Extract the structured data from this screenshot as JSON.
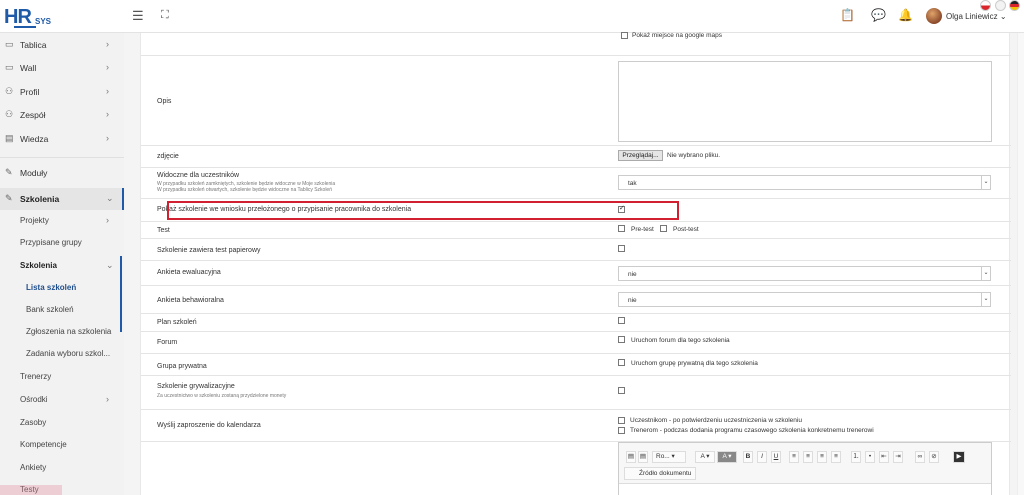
{
  "header": {
    "logo_main": "HR",
    "logo_sub": "SYS",
    "user_name": "Olga Liniewicz",
    "user_chevron": "⌄",
    "icons": [
      "menu-icon",
      "fullscreen-icon",
      "clipboard-icon",
      "chat-icon",
      "bell-icon"
    ]
  },
  "sidebar": {
    "items": [
      {
        "label": "Tablica",
        "icon": "dashboard-icon"
      },
      {
        "label": "Wall",
        "icon": "wall-icon"
      },
      {
        "label": "Profil",
        "icon": "user-icon"
      },
      {
        "label": "Zespół",
        "icon": "team-icon"
      },
      {
        "label": "Wiedza",
        "icon": "book-icon"
      },
      {
        "label": "Moduły",
        "icon": "wrench-icon"
      },
      {
        "label": "Szkolenia",
        "icon": "wrench-icon"
      }
    ],
    "sub_items": {
      "projekty": "Projekty",
      "przypisane_grupy": "Przypisane grupy",
      "szkolenia": "Szkolenia",
      "lista_szkolen": "Lista szkoleń",
      "bank_szkolen": "Bank szkoleń",
      "zgloszenia": "Zgłoszenia na szkolenia",
      "zadania": "Zadania wyboru szkol...",
      "trenerzy": "Trenerzy",
      "osrodki": "Ośrodki",
      "zasoby": "Zasoby",
      "kompetencje": "Kompetencje",
      "ankiety": "Ankiety",
      "testy": "Testy"
    }
  },
  "form": {
    "google_maps_label": "Pokaż miejsce na google maps",
    "opis_label": "Opis",
    "zdjecie_label": "zdjęcie",
    "file_button": "Przeglądaj...",
    "file_none": "Nie wybrano pliku.",
    "widoczne_label": "Widoczne dla uczestników",
    "widoczne_help1": "W przypadku szkoleń zamkniętych, szkolenie będzie widoczne w Moje szkolenia",
    "widoczne_help2": "W przypadku szkoleń otwartych, szkolenie będzie widoczne na Tablicy Szkoleń",
    "widoczne_value": "tak",
    "pokaz_label": "Pokaż szkolenie we wniosku przełożonego o przypisanie pracownika do szkolenia",
    "test_label": "Test",
    "pretest_label": "Pre-test",
    "posttest_label": "Post-test",
    "papierowy_label": "Szkolenie zawiera test papierowy",
    "ankieta_ewal_label": "Ankieta ewaluacyjna",
    "ankieta_ewal_value": "nie",
    "ankieta_beh_label": "Ankieta behawioralna",
    "ankieta_beh_value": "nie",
    "plan_label": "Plan szkoleń",
    "forum_label": "Forum",
    "forum_option": "Uruchom forum dla tego szkolenia",
    "grupa_label": "Grupa prywatna",
    "grupa_option": "Uruchom grupę prywatną dla tego szkolenia",
    "grywal_label": "Szkolenie grywalizacyjne",
    "grywal_help": "Za uczestnictwo w szkoleniu zostaną przydzielone monety",
    "kalendarz_label": "Wyślij zaproszenie do kalendarza",
    "kalendarz_opt1": "Uczestnikom - po potwierdzeniu uczestniczenia w szkoleniu",
    "kalendarz_opt2": "Trenerom - podczas dodania programu czasowego szkolenia konkretnemu trenerowi"
  },
  "editor": {
    "font_select": "Ro...",
    "bold": "B",
    "italic": "I",
    "underline": "U",
    "source_label": "Źródło dokumentu",
    "font_color": "A",
    "bg_color": "A"
  },
  "colors": {
    "accent": "#1e5aa8",
    "highlight": "#d32030"
  }
}
